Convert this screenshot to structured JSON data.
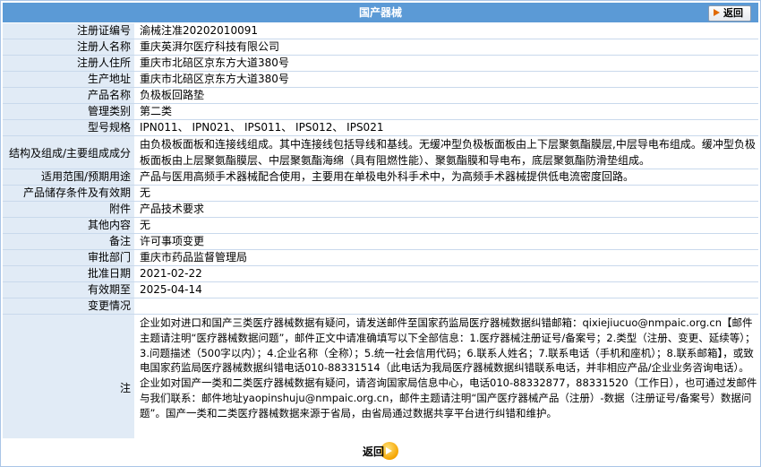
{
  "header": {
    "title": "国产器械",
    "back_label": "返回"
  },
  "fields": [
    {
      "label": "注册证编号",
      "value": "渝械注准20202010091"
    },
    {
      "label": "注册人名称",
      "value": "重庆英湃尔医疗科技有限公司"
    },
    {
      "label": "注册人住所",
      "value": "重庆市北碚区京东方大道380号"
    },
    {
      "label": "生产地址",
      "value": "重庆市北碚区京东方大道380号"
    },
    {
      "label": "产品名称",
      "value": "负极板回路垫"
    },
    {
      "label": "管理类别",
      "value": "第二类"
    },
    {
      "label": "型号规格",
      "value": "IPN011、 IPN021、 IPS011、 IPS012、 IPS021"
    },
    {
      "label": "结构及组成/主要组成成分",
      "value": "由负极板面板和连接线组成。其中连接线包括导线和基线。无缓冲型负极板面板由上下层聚氨酯膜层,中层导电布组成。缓冲型负极板面板由上层聚氨酯膜层、中层聚氨酯海绵（具有阻燃性能）、聚氨酯膜和导电布，底层聚氨酯防滑垫组成。"
    },
    {
      "label": "适用范围/预期用途",
      "value": "产品与医用高频手术器械配合使用，主要用在单极电外科手术中，为高频手术器械提供低电流密度回路。"
    },
    {
      "label": "产品储存条件及有效期",
      "value": "无"
    },
    {
      "label": "附件",
      "value": "产品技术要求"
    },
    {
      "label": "其他内容",
      "value": "无"
    },
    {
      "label": "备注",
      "value": "许可事项变更"
    },
    {
      "label": "审批部门",
      "value": "重庆市药品监督管理局"
    },
    {
      "label": "批准日期",
      "value": "2021-02-22"
    },
    {
      "label": "有效期至",
      "value": "2025-04-14"
    },
    {
      "label": "变更情况",
      "value": ""
    }
  ],
  "note": {
    "label": "注",
    "text": "企业如对进口和国产三类医疗器械数据有疑问，请发送邮件至国家药监局医疗器械数据纠错邮箱：qixiejiucuo@nmpaic.org.cn【邮件主题请注明“医疗器械数据问题”，邮件正文中请准确填写以下全部信息：1.医疗器械注册证号/备案号；2.类型（注册、变更、延续等）；3.问题描述（500字以内）；4.企业名称（全称）；5.统一社会信用代码；6.联系人姓名；7.联系电话（手机和座机）；8.联系邮箱】，或致电国家药监局医疗器械数据纠错电话010-88331514（此电话为我局医疗器械数据纠错联系电话，并非相应产品/企业业务咨询电话）。企业如对国产一类和二类医疗器械数据有疑问，请咨询国家局信息中心，电话010-88332877，88331520（工作日），也可通过发邮件与我们联系：邮件地址yaopinshuju@nmpaic.org.cn，邮件主题请注明“国产医疗器械产品（注册）-数据（注册证号/备案号）数据问题”。国产一类和二类医疗器械数据来源于省局，由省局通过数据共享平台进行纠错和维护。"
  },
  "footer": {
    "back_label": "返回"
  }
}
